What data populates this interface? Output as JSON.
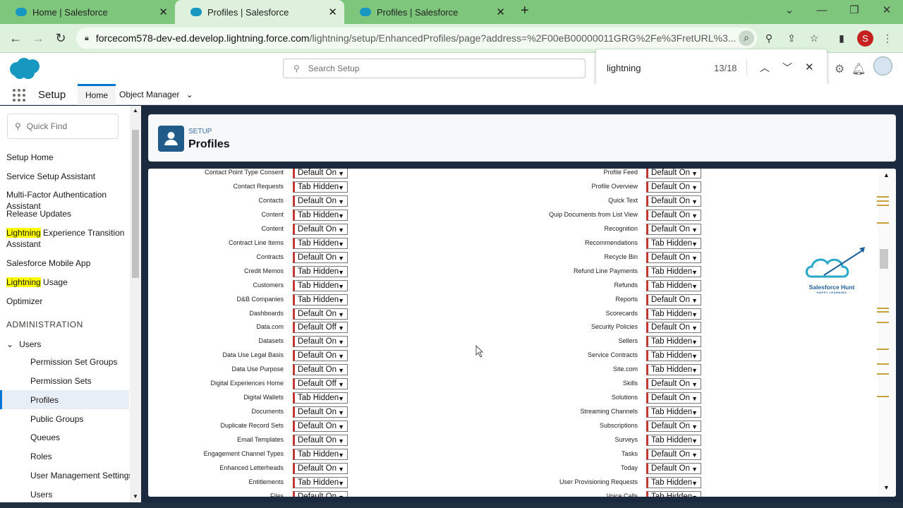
{
  "browser": {
    "tabs": [
      {
        "title": "Home | Salesforce",
        "active": false
      },
      {
        "title": "Profiles | Salesforce",
        "active": true
      },
      {
        "title": "Profiles | Salesforce",
        "active": false
      }
    ],
    "url_domain": "forcecom578-dev-ed.develop.lightning.force.com",
    "url_path": "/lightning/setup/EnhancedProfiles/page?address=%2F00eB00000011GRG%2Fe%3FretURL%3...",
    "profile_initial": "S"
  },
  "find": {
    "query": "lightning",
    "count": "13/18"
  },
  "header": {
    "search_placeholder": "Search Setup"
  },
  "setup_nav": {
    "title": "Setup",
    "tabs": [
      "Home",
      "Object Manager"
    ]
  },
  "sidebar": {
    "quick_find_placeholder": "Quick Find",
    "items": [
      "Setup Home",
      "Service Setup Assistant",
      "Multi-Factor Authentication Assistant",
      "Release Updates"
    ],
    "lightning_transition": {
      "highlight": "Lightning",
      "rest": " Experience Transition Assistant"
    },
    "mobile_app": "Salesforce Mobile App",
    "lightning_usage": {
      "highlight": "Lightning",
      "rest": " Usage"
    },
    "optimizer": "Optimizer",
    "section": "ADMINISTRATION",
    "group": "Users",
    "sub_items": [
      "Permission Set Groups",
      "Permission Sets",
      "Profiles",
      "Public Groups",
      "Queues",
      "Roles",
      "User Management Settings",
      "Users"
    ]
  },
  "page": {
    "eyebrow": "SETUP",
    "title": "Profiles"
  },
  "tab_settings_left": [
    {
      "label": "Contact Point Type Consent",
      "value": "Default On"
    },
    {
      "label": "Contact Requests",
      "value": "Tab Hidden"
    },
    {
      "label": "Contacts",
      "value": "Default On"
    },
    {
      "label": "Content",
      "value": "Tab Hidden"
    },
    {
      "label": "Content",
      "value": "Default On"
    },
    {
      "label": "Contract Line Items",
      "value": "Tab Hidden"
    },
    {
      "label": "Contracts",
      "value": "Default On"
    },
    {
      "label": "Credit Memos",
      "value": "Tab Hidden"
    },
    {
      "label": "Customers",
      "value": "Tab Hidden"
    },
    {
      "label": "D&B Companies",
      "value": "Tab Hidden"
    },
    {
      "label": "Dashboards",
      "value": "Default On"
    },
    {
      "label": "Data.com",
      "value": "Default Off"
    },
    {
      "label": "Datasets",
      "value": "Default On"
    },
    {
      "label": "Data Use Legal Basis",
      "value": "Default On"
    },
    {
      "label": "Data Use Purpose",
      "value": "Default On"
    },
    {
      "label": "Digital Experiences Home",
      "value": "Default Off"
    },
    {
      "label": "Digital Wallets",
      "value": "Tab Hidden"
    },
    {
      "label": "Documents",
      "value": "Default On"
    },
    {
      "label": "Duplicate Record Sets",
      "value": "Default On"
    },
    {
      "label": "Email Templates",
      "value": "Default On"
    },
    {
      "label": "Engagement Channel Types",
      "value": "Tab Hidden"
    },
    {
      "label": "Enhanced Letterheads",
      "value": "Default On"
    },
    {
      "label": "Entitlements",
      "value": "Tab Hidden"
    },
    {
      "label": "Files",
      "value": "Default On"
    }
  ],
  "tab_settings_right": [
    {
      "label": "Profile Feed",
      "value": "Default On"
    },
    {
      "label": "Profile Overview",
      "value": "Default On"
    },
    {
      "label": "Quick Text",
      "value": "Default On"
    },
    {
      "label": "Quip Documents from List View",
      "value": "Default On"
    },
    {
      "label": "Recognition",
      "value": "Default On"
    },
    {
      "label": "Recommendations",
      "value": "Tab Hidden"
    },
    {
      "label": "Recycle Bin",
      "value": "Default On"
    },
    {
      "label": "Refund Line Payments",
      "value": "Tab Hidden"
    },
    {
      "label": "Refunds",
      "value": "Tab Hidden"
    },
    {
      "label": "Reports",
      "value": "Default On"
    },
    {
      "label": "Scorecards",
      "value": "Tab Hidden"
    },
    {
      "label": "Security Policies",
      "value": "Default On"
    },
    {
      "label": "Sellers",
      "value": "Tab Hidden"
    },
    {
      "label": "Service Contracts",
      "value": "Tab Hidden"
    },
    {
      "label": "Site.com",
      "value": "Tab Hidden"
    },
    {
      "label": "Skills",
      "value": "Default On"
    },
    {
      "label": "Solutions",
      "value": "Default On"
    },
    {
      "label": "Streaming Channels",
      "value": "Tab Hidden"
    },
    {
      "label": "Subscriptions",
      "value": "Default On"
    },
    {
      "label": "Surveys",
      "value": "Tab Hidden"
    },
    {
      "label": "Tasks",
      "value": "Default On"
    },
    {
      "label": "Today",
      "value": "Default On"
    },
    {
      "label": "User Provisioning Requests",
      "value": "Tab Hidden"
    },
    {
      "label": "Voice Calls",
      "value": "Tab Hidden"
    }
  ],
  "watermark": {
    "title": "Salesforce Hunt",
    "subtitle": "HAPPY LEARNING"
  },
  "colors": {
    "tabbar": "#7fc67d",
    "addressbar": "#ddf1dc",
    "brand_blue": "#0176d3",
    "required_bar": "#c23934",
    "find_highlight": "#ffff00"
  }
}
